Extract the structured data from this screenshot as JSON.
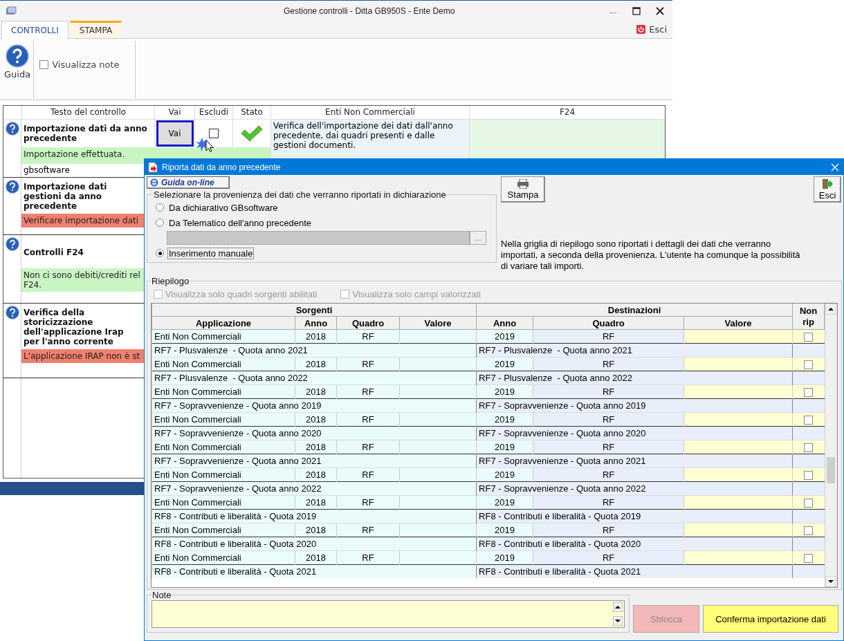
{
  "window": {
    "title": "Gestione controlli - Ditta GB950S - Ente Demo",
    "exit": "Esci"
  },
  "tabs": [
    {
      "label": "CONTROLLI",
      "selected": true
    },
    {
      "label": "STAMPA",
      "selected": false
    }
  ],
  "ribbon": {
    "help": "Guida",
    "show_notes": {
      "label": "Visualizza note",
      "checked": false
    }
  },
  "controls_table": {
    "columns": [
      "Testo del controllo",
      "Vai",
      "Escludi",
      "Stato",
      "Enti Non Commerciali",
      "F24"
    ],
    "rows": [
      {
        "title": "Importazione dati da anno precedente",
        "go": "Vai",
        "excluded": false,
        "passed": true,
        "description": "Verifica dell'importazione dei dati dall'anno precedente, dai quadri presenti e dalle gestioni documenti.",
        "message_lines": [
          "Importazione effettuata."
        ],
        "color": "#c9f5c2",
        "source": "gbsoftware"
      },
      {
        "title": "Importazione dati gestioni da anno precedente",
        "message_lines": [
          "Verificare importazione dati"
        ],
        "color": "#f08070"
      },
      {
        "title": "Controlli F24",
        "message_lines": [
          "Non ci sono debiti/crediti rel",
          "F24."
        ],
        "color": "#c9f5c2"
      },
      {
        "title": "Verifica della storicizzazione dell'applicazione Irap per l'anno corrente",
        "message_lines": [
          "L'applicazione IRAP non è st"
        ],
        "color": "#f08070"
      }
    ]
  },
  "dialog": {
    "title": "Riporta dati da anno precedente",
    "help_button": "Guida on-line",
    "print_button": "Stampa",
    "exit_button": "Esci",
    "source_group": {
      "legend": "Selezionare la provenienza dei dati che verranno riportati in dichiarazione",
      "options": [
        {
          "label": "Da dichiarativo GBsoftware",
          "selected": false
        },
        {
          "label": "Da Telematico dell'anno precedente",
          "selected": false
        },
        {
          "label": "Inserimento manuale",
          "selected": true
        }
      ],
      "file_field": {
        "disabled": true
      },
      "browse_button": "..."
    },
    "info": "Nella griglia di riepilogo sono riportati i dettagli dei dati che verranno importati, a seconda della provenienza. L'utente ha comunque la possibilità di variare tali importi.",
    "summary": {
      "legend": "Riepilogo",
      "filters": [
        {
          "label": "Visualizza solo quadri sorgenti abilitati",
          "checked": false,
          "disabled": true
        },
        {
          "label": "Visualizza solo campi valorizzati",
          "checked": false,
          "disabled": true
        }
      ],
      "groups": [
        "Sorgenti",
        "Destinazioni"
      ],
      "columns": [
        "Applicazione",
        "Anno",
        "Quadro",
        "Valore",
        "Anno",
        "Quadro",
        "Valore"
      ],
      "non_rip": "Non rip",
      "rows": [
        {
          "kind": "detail",
          "application": "Enti Non Commerciali",
          "source_year": "2018",
          "source_frame": "RF",
          "target_year": "2019",
          "target_frame": "RF",
          "non_rip": false
        },
        {
          "kind": "title",
          "source": "RF7 - Plusvalenze  - Quota anno 2021",
          "target": "RF7 - Plusvalenze  - Quota anno 2021"
        },
        {
          "kind": "detail",
          "application": "Enti Non Commerciali",
          "source_year": "2018",
          "source_frame": "RF",
          "target_year": "2019",
          "target_frame": "RF",
          "non_rip": false
        },
        {
          "kind": "title",
          "source": "RF7 - Plusvalenze  - Quota anno 2022",
          "target": "RF7 - Plusvalenze  - Quota anno 2022"
        },
        {
          "kind": "detail",
          "application": "Enti Non Commerciali",
          "source_year": "2018",
          "source_frame": "RF",
          "target_year": "2019",
          "target_frame": "RF",
          "non_rip": false
        },
        {
          "kind": "title",
          "source": "RF7 - Sopravvenienze - Quota anno 2019",
          "target": "RF7 - Sopravvenienze - Quota anno 2019"
        },
        {
          "kind": "detail",
          "application": "Enti Non Commerciali",
          "source_year": "2018",
          "source_frame": "RF",
          "target_year": "2019",
          "target_frame": "RF",
          "non_rip": false
        },
        {
          "kind": "title",
          "source": "RF7 - Sopravvenienze - Quota anno 2020",
          "target": "RF7 - Sopravvenienze - Quota anno 2020"
        },
        {
          "kind": "detail",
          "application": "Enti Non Commerciali",
          "source_year": "2018",
          "source_frame": "RF",
          "target_year": "2019",
          "target_frame": "RF",
          "non_rip": false
        },
        {
          "kind": "title",
          "source": "RF7 - Sopravvenienze - Quota anno 2021",
          "target": "RF7 - Sopravvenienze - Quota anno 2021"
        },
        {
          "kind": "detail",
          "application": "Enti Non Commerciali",
          "source_year": "2018",
          "source_frame": "RF",
          "target_year": "2019",
          "target_frame": "RF",
          "non_rip": false
        },
        {
          "kind": "title",
          "source": "RF7 - Sopravvenienze - Quota anno 2022",
          "target": "RF7 - Sopravvenienze - Quota anno 2022"
        },
        {
          "kind": "detail",
          "application": "Enti Non Commerciali",
          "source_year": "2018",
          "source_frame": "RF",
          "target_year": "2019",
          "target_frame": "RF",
          "non_rip": false
        },
        {
          "kind": "title",
          "source": "RF8 - Contributi e liberalità - Quota 2019",
          "target": "RF8 - Contributi e liberalità - Quota 2019"
        },
        {
          "kind": "detail",
          "application": "Enti Non Commerciali",
          "source_year": "2018",
          "source_frame": "RF",
          "target_year": "2019",
          "target_frame": "RF",
          "non_rip": false
        },
        {
          "kind": "title",
          "source": "RF8 - Contributi e liberalità - Quota 2020",
          "target": "RF8 - Contributi e liberalità - Quota 2020"
        },
        {
          "kind": "detail",
          "application": "Enti Non Commerciali",
          "source_year": "2018",
          "source_frame": "RF",
          "target_year": "2019",
          "target_frame": "RF",
          "non_rip": false
        },
        {
          "kind": "title",
          "source": "RF8 - Contributi e liberalità - Quota 2021",
          "target": "RF8 - Contributi e liberalità - Quota 2021"
        }
      ]
    },
    "notes": {
      "legend": "Note"
    },
    "unlock_button": {
      "label": "Sblocca",
      "disabled": true
    },
    "confirm_button": "Conferma importazione dati"
  }
}
